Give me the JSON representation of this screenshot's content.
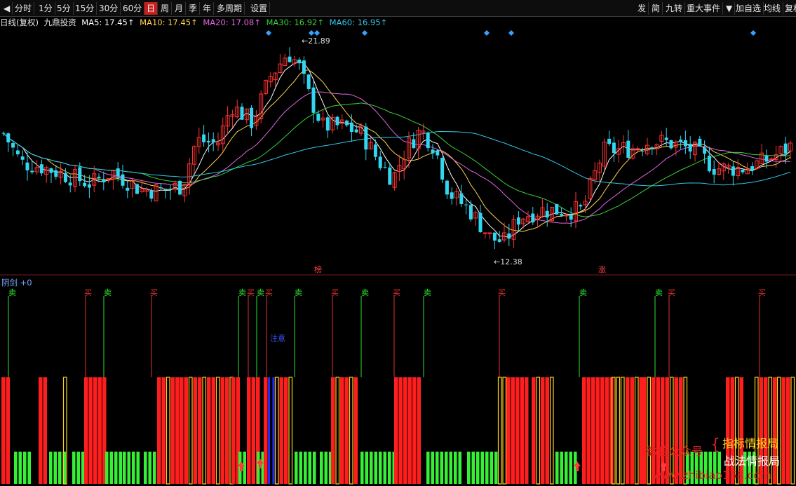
{
  "toolbar": {
    "back_glyph": "◀",
    "left": [
      {
        "label": "分时"
      },
      {
        "label": "1分"
      },
      {
        "label": "5分"
      },
      {
        "label": "15分"
      },
      {
        "label": "30分"
      },
      {
        "label": "60分"
      },
      {
        "label": "日",
        "active": true
      },
      {
        "label": "周"
      },
      {
        "label": "月"
      },
      {
        "label": "季"
      },
      {
        "label": "年"
      },
      {
        "label": "多周期"
      },
      {
        "label": "设置"
      }
    ],
    "right": [
      {
        "label": "发"
      },
      {
        "label": "简"
      },
      {
        "label": "九转"
      },
      {
        "label": "重大事件"
      },
      {
        "label": "▼"
      },
      {
        "label": "加自选"
      },
      {
        "label": "均线"
      },
      {
        "label": "复权"
      }
    ]
  },
  "info": {
    "period": "日线(复权)",
    "name": "九鼎投资",
    "ma5": {
      "label": "MA5: 17.45↑",
      "color": "#ffffff"
    },
    "ma10": {
      "label": "MA10: 17.45↑",
      "color": "#ffd34d"
    },
    "ma20": {
      "label": "MA20: 17.08↑",
      "color": "#e066e0"
    },
    "ma30": {
      "label": "MA30: 16.92↑",
      "color": "#3ad13a"
    },
    "ma60": {
      "label": "MA60: 16.95↑",
      "color": "#33c6e6"
    }
  },
  "annotations": {
    "high": "21.89",
    "low": "12.38",
    "mark1": "榜",
    "mark2": "涨",
    "attention": "注意"
  },
  "indicator": {
    "name": "阴剑",
    "value": "+0",
    "buy": "买",
    "sell": "卖"
  },
  "watermark": {
    "wechat": "微信公众号",
    "name1": "指标情报局",
    "name2": "战法情报局",
    "url": "www.zhibiao168.com"
  },
  "colors": {
    "up": "#ff3232",
    "down": "#33d6f0",
    "bar_red": "#ff1e1e",
    "bar_yellow": "#ffd21e",
    "bar_green": "#36f036",
    "sell_line": "#2ee02e",
    "buy_line": "#e03030"
  },
  "chart_data": {
    "type": "candlestick",
    "price_range": [
      11.8,
      22.6
    ],
    "candles": [],
    "signals": {
      "sell": [
        12,
        148,
        340,
        366,
        420,
        515,
        604,
        826,
        934
      ],
      "buy": [
        122,
        216,
        354,
        380,
        474,
        562,
        712,
        954,
        1083
      ],
      "diamonds": [
        383,
        444,
        452,
        520,
        694,
        729,
        1074
      ]
    }
  }
}
